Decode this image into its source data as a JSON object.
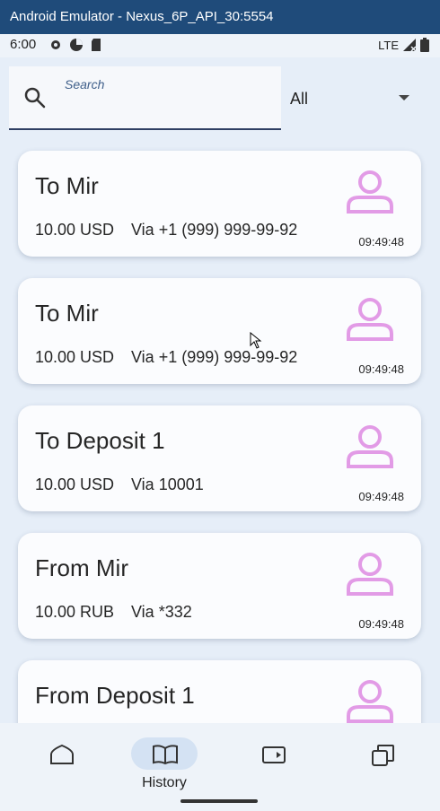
{
  "window": {
    "title": "Android Emulator - Nexus_6P_API_30:5554"
  },
  "status_bar": {
    "time": "6:00",
    "network": "LTE"
  },
  "search": {
    "label": "Search",
    "value": ""
  },
  "filter": {
    "selected": "All"
  },
  "transactions": [
    {
      "title": "To Mir",
      "amount": "10.00 USD",
      "via": "Via +1 (999) 999-99-92",
      "time": "09:49:48"
    },
    {
      "title": "To Mir",
      "amount": "10.00 USD",
      "via": "Via +1 (999) 999-99-92",
      "time": "09:49:48"
    },
    {
      "title": "To Deposit 1",
      "amount": "10.00 USD",
      "via": "Via 10001",
      "time": "09:49:48"
    },
    {
      "title": "From Mir",
      "amount": "10.00 RUB",
      "via": "Via *332",
      "time": "09:49:48"
    },
    {
      "title": "From Deposit 1",
      "amount": "",
      "via": "",
      "time": ""
    }
  ],
  "nav": {
    "items": [
      {
        "id": "home",
        "label": "",
        "icon": "home-icon"
      },
      {
        "id": "history",
        "label": "History",
        "icon": "book-icon",
        "active": true
      },
      {
        "id": "payments",
        "label": "",
        "icon": "card-icon"
      },
      {
        "id": "accounts",
        "label": "",
        "icon": "copy-icon"
      }
    ]
  },
  "colors": {
    "accent": "#2f3f63",
    "avatar": "#e29be6",
    "background": "#e6eef8",
    "card": "#fbfcfe",
    "nav_active": "#d4e2f3"
  }
}
